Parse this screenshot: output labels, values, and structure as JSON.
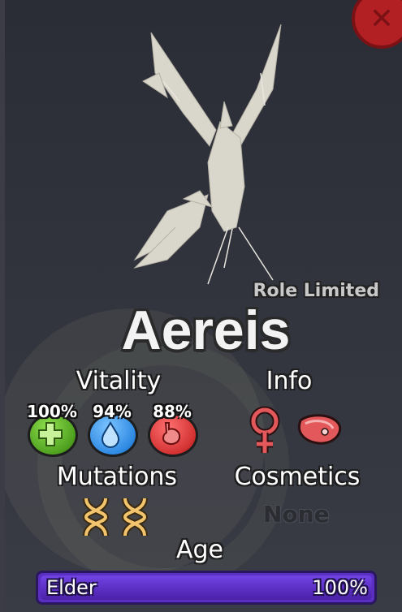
{
  "creature": {
    "name": "Aereis",
    "role_note": "Role Limited"
  },
  "close_button": {
    "icon": "close-icon",
    "color": "#b32024"
  },
  "sections": {
    "vitality": "Vitality",
    "info": "Info",
    "mutations": "Mutations",
    "cosmetics": "Cosmetics",
    "age": "Age"
  },
  "vitality": [
    {
      "name": "health",
      "icon": "health-plus-icon",
      "value": "100%",
      "color": "#5ab52a"
    },
    {
      "name": "thirst",
      "icon": "water-drop-icon",
      "value": "94%",
      "color": "#2f8ae3"
    },
    {
      "name": "hunger",
      "icon": "stomach-icon",
      "value": "88%",
      "color": "#d33232"
    }
  ],
  "info": {
    "sex_icon": "female-symbol-icon",
    "diet_icon": "meat-icon",
    "accent": "#e3585a"
  },
  "mutations": {
    "count": 2,
    "icon": "dna-icon",
    "color": "#f2c46e"
  },
  "cosmetics": {
    "value": "None"
  },
  "age": {
    "stage": "Elder",
    "percent": "100%",
    "fill": 1.0,
    "color": "#5a2ec0"
  }
}
